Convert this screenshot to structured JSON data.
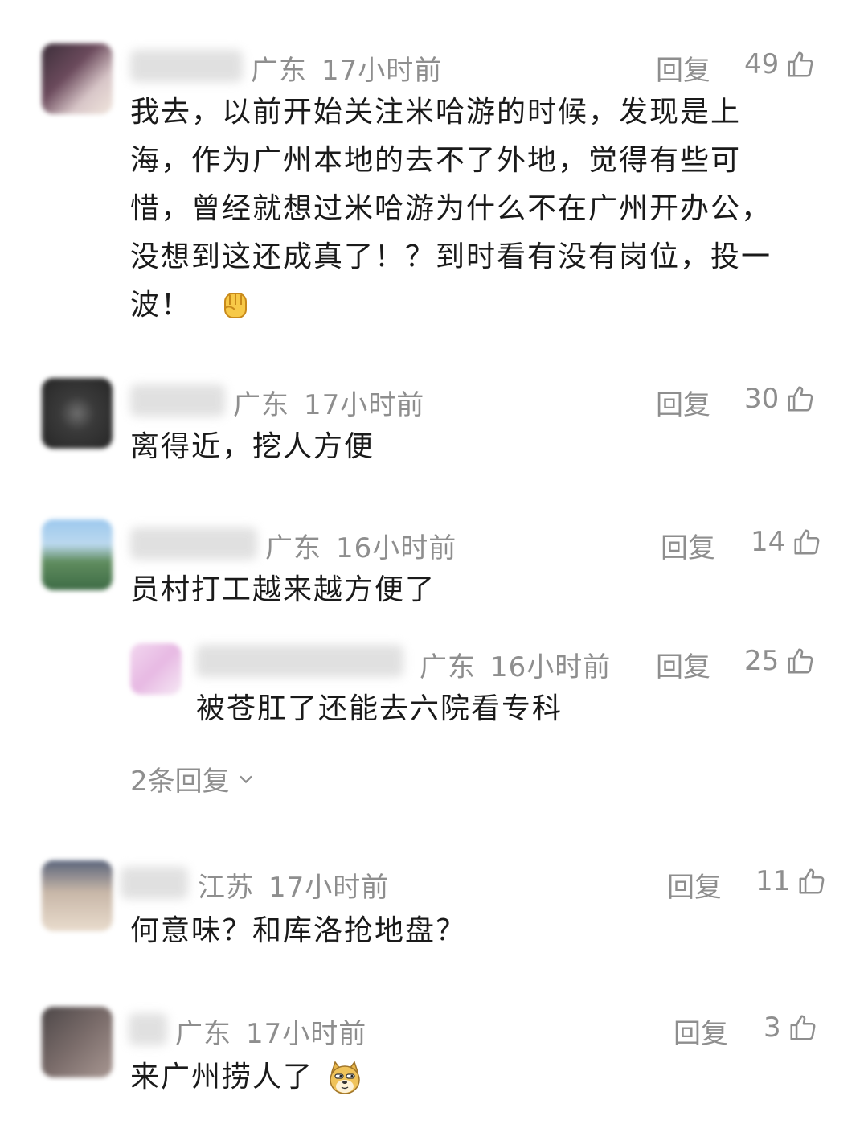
{
  "comments": [
    {
      "location": "广东",
      "time": "17小时前",
      "reply_label": "回复",
      "likes": "49",
      "text_lines": [
        "我去，以前开始关注米哈游的时候，发现是上",
        "海，作为广州本地的去不了外地，觉得有些可",
        "惜，曾经就想过米哈游为什么不在广州开办公，",
        "没想到这还成真了！？到时看有没有岗位，投一",
        "波！"
      ],
      "emoji": "raised-fist-emoji"
    },
    {
      "location": "广东",
      "time": "17小时前",
      "reply_label": "回复",
      "likes": "30",
      "text_lines": [
        "离得近，挖人方便"
      ]
    },
    {
      "location": "广东",
      "time": "16小时前",
      "reply_label": "回复",
      "likes": "14",
      "text_lines": [
        "员村打工越来越方便了"
      ],
      "sub_reply": {
        "location": "广东",
        "time": "16小时前",
        "reply_label": "回复",
        "likes": "25",
        "text": "被苍肛了还能去六院看专科"
      },
      "more_replies": "2条回复"
    },
    {
      "location": "江苏",
      "time": "17小时前",
      "reply_label": "回复",
      "likes": "11",
      "text_lines": [
        "何意味？和库洛抢地盘？"
      ]
    },
    {
      "location": "广东",
      "time": "17小时前",
      "reply_label": "回复",
      "likes": "3",
      "text_lines": [
        "来广州捞人了"
      ],
      "emoji": "doge-emoji"
    }
  ],
  "colors": {
    "text": "#1a1a1a",
    "meta": "#8e8e8e",
    "background": "#ffffff"
  }
}
